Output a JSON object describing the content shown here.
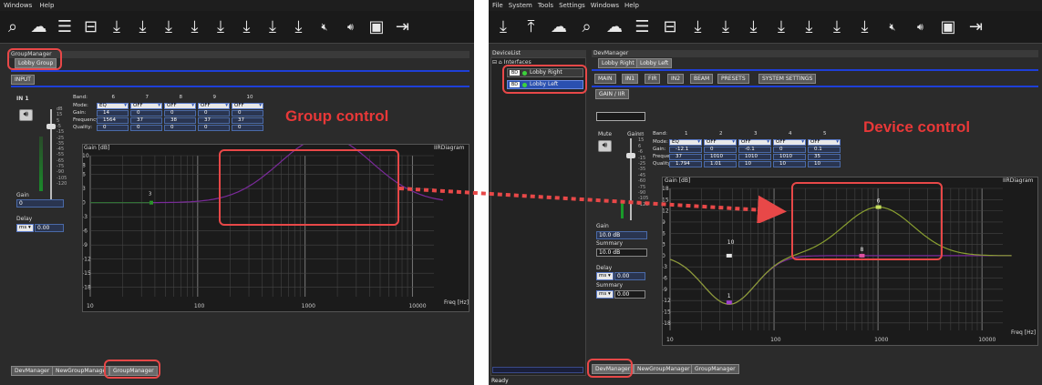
{
  "left": {
    "menu": [
      "Windows",
      "Help"
    ],
    "group_manager_title": "GroupManager",
    "group_tab": "Lobby Group",
    "input_tab": "INPUT",
    "channel": "IN 1",
    "band_header": [
      "Band:",
      "6",
      "7",
      "8",
      "9",
      "10"
    ],
    "row_labels": [
      "Mode:",
      "Gain:",
      "Frequency:",
      "Quality:"
    ],
    "mode_values": [
      "EQ",
      "OFF",
      "OFF",
      "OFF",
      "OFF"
    ],
    "gain_values": [
      "14",
      "0",
      "0",
      "0",
      "0"
    ],
    "freq_values": [
      "1564",
      "37",
      "38",
      "37",
      "37"
    ],
    "q_values": [
      "0",
      "0",
      "0",
      "0",
      "0"
    ],
    "meter_scale": [
      "dB",
      "15",
      "5",
      "-5",
      "-15",
      "-25",
      "-35",
      "-45",
      "-55",
      "-65",
      "-75",
      "-90",
      "-105",
      "-120"
    ],
    "gain_label": "Gain",
    "gain_value": "0",
    "delay_label": "Delay",
    "delay_unit": "ms",
    "delay_value": "0.00",
    "graph": {
      "ylabel": "Gain [dB]",
      "title": "IIRDiagram",
      "xlabel": "Freq [Hz]",
      "y_ticks": [
        "10",
        "8",
        "6",
        "3",
        "0",
        "-3",
        "-6",
        "-9",
        "-12",
        "-15",
        "-18"
      ],
      "x_ticks": [
        "10",
        "100",
        "1000",
        "10000"
      ],
      "band_marker": "6",
      "marker_small": "3"
    },
    "annotation": "Group control",
    "bottom_tabs": [
      "DevManager",
      "NewGroupManage",
      "GroupManager"
    ]
  },
  "right": {
    "menu": [
      "File",
      "System",
      "Tools",
      "Settings",
      "Windows",
      "Help"
    ],
    "device_list_title": "DeviceList",
    "tree_root": "Interfaces",
    "devices": [
      "Lobby Right",
      "Lobby Left"
    ],
    "dev_manager_title": "DevManager",
    "device_tabs": [
      "Lobby Right",
      "Lobby Left"
    ],
    "channel_tabs": [
      "MAIN",
      "IN1",
      "FIR",
      "IN2",
      "BEAM",
      "PRESETS",
      "SYSTEM SETTINGS"
    ],
    "sub_tab": "GAIN / IIR",
    "mute_label": "Mute",
    "gain_head": "Gain",
    "band_header": [
      "Band:",
      "1",
      "2",
      "3",
      "4",
      "5"
    ],
    "row_labels": [
      "Mode:",
      "Gain:",
      "Frequency:",
      "Quality:"
    ],
    "mode_values": [
      "EQ",
      "OFF",
      "OFF",
      "OFF",
      "OFF"
    ],
    "gain_values": [
      "-12.1",
      "0",
      "-0.1",
      "0",
      "0.1"
    ],
    "freq_values": [
      "37",
      "1010",
      "1010",
      "1010",
      "35"
    ],
    "q_values": [
      "1.794",
      "1.01",
      "10",
      "10",
      "10"
    ],
    "meter_scale": [
      "dB",
      "15",
      "6",
      "-6",
      "-15",
      "-25",
      "-35",
      "-45",
      "-60",
      "-75",
      "-90",
      "-105",
      "-120"
    ],
    "gain_label": "Gain",
    "gain_value": "10.0 dB",
    "summary_label": "Summary",
    "summary_value": "10.0 dB",
    "delay_label": "Delay",
    "delay_unit": "ms",
    "delay_value": "0.00",
    "summary2_label": "Summary",
    "summary2_unit": "ms",
    "summary2_value": "0.00",
    "graph": {
      "ylabel": "Gain [dB]",
      "title": "IIRDiagram",
      "xlabel": "Freq [Hz]",
      "y_ticks": [
        "18",
        "15",
        "12",
        "9",
        "6",
        "3",
        "0",
        "-3",
        "-6",
        "-9",
        "-12",
        "-15",
        "-18"
      ],
      "x_ticks": [
        "10",
        "100",
        "1000",
        "10000"
      ],
      "marker_labels": [
        "6",
        "1",
        "10",
        "8"
      ]
    },
    "annotation": "Device control",
    "bottom_tabs": [
      "DevManager",
      "NewGroupManager",
      "GroupManager"
    ],
    "status": "Ready"
  },
  "colors": {
    "annotation": "#e83838",
    "highlight": "#e84848",
    "curve_left": "#7a2a9a",
    "curve_right_a": "#8aa030",
    "curve_right_b": "#7a2a9a",
    "marker_green": "#7be04a"
  },
  "icons": {
    "toolbar_left": [
      "search-icon",
      "cloud-upload-icon",
      "sliders-icon",
      "layout-icon",
      "download-icon",
      "download-icon",
      "download-icon",
      "download-icon",
      "download-icon",
      "download-icon",
      "download-icon",
      "download-icon",
      "mute-icon",
      "speaker-icon",
      "save-icon",
      "exit-icon"
    ],
    "toolbar_right": [
      "download-icon",
      "upload-icon",
      "cloud-upload-icon",
      "search-icon",
      "cloud-download-icon",
      "sliders-icon",
      "layout-icon",
      "download-icon",
      "download-icon",
      "download-icon",
      "download-icon",
      "download-icon",
      "download-icon",
      "download-icon",
      "mute-icon",
      "speaker-icon",
      "save-icon",
      "exit-icon"
    ]
  }
}
